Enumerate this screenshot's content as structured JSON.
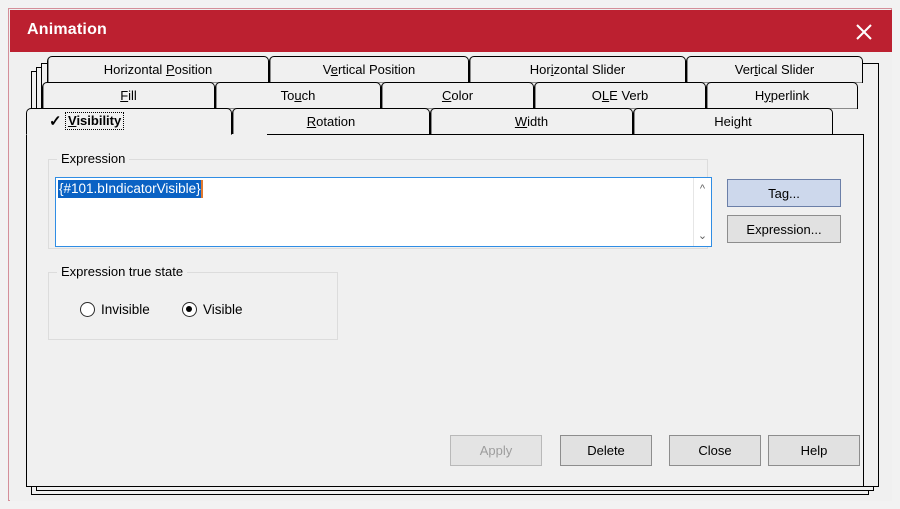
{
  "window": {
    "title": "Animation",
    "titlebar_color": "#bc2030",
    "close_icon": "close-icon",
    "border_color": "#d48f99"
  },
  "tabs": {
    "rows": [
      [
        {
          "label": "Horizontal Position",
          "accel": "P",
          "active": false
        },
        {
          "label": "Vertical Position",
          "accel": "e",
          "active": false
        },
        {
          "label": "Horizontal Slider",
          "accel": "i",
          "active": false
        },
        {
          "label": "Vertical Slider",
          "accel": "t",
          "active": false
        }
      ],
      [
        {
          "label": "Fill",
          "accel": "F",
          "active": false
        },
        {
          "label": "Touch",
          "accel": "u",
          "active": false
        },
        {
          "label": "Color",
          "accel": "C",
          "active": false
        },
        {
          "label": "OLE Verb",
          "accel": "L",
          "active": false
        },
        {
          "label": "Hyperlink",
          "accel": "y",
          "active": false
        }
      ],
      [
        {
          "label": "Visibility",
          "accel": "V",
          "active": true,
          "check": "✓"
        },
        {
          "label": "Rotation",
          "accel": "R",
          "active": false
        },
        {
          "label": "Width",
          "accel": "W",
          "active": false
        },
        {
          "label": "Height",
          "accel": "g",
          "active": false
        }
      ]
    ]
  },
  "expression_group": {
    "label": "Expression",
    "value": "{#101.bIndicatorVisible}",
    "selected": true,
    "selection_color": "#0a62c4",
    "caret_color": "#e07a30",
    "scroll_up_icon": "chevron-up-icon",
    "scroll_down_icon": "chevron-down-icon",
    "tag_button": "Tag...",
    "expression_button": "Expression..."
  },
  "true_state_group": {
    "label": "Expression true state",
    "options": [
      {
        "label": "Invisible",
        "checked": false
      },
      {
        "label": "Visible",
        "checked": true
      }
    ]
  },
  "footer": {
    "apply": "Apply",
    "apply_enabled": false,
    "delete": "Delete",
    "close": "Close",
    "help": "Help"
  }
}
